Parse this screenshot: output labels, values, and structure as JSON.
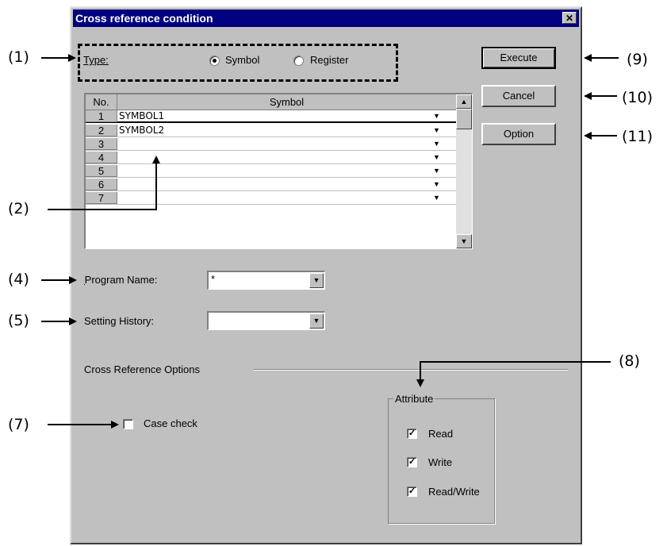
{
  "dialog": {
    "title": "Cross reference condition",
    "close_label": "✕"
  },
  "type_group": {
    "label": "Type:",
    "options": [
      {
        "label": "Symbol",
        "selected": true
      },
      {
        "label": "Register",
        "selected": false
      }
    ]
  },
  "grid": {
    "headers": [
      "No.",
      "Symbol"
    ],
    "rows": [
      {
        "no": "1",
        "value": "SYMBOL1"
      },
      {
        "no": "2",
        "value": "SYMBOL2"
      },
      {
        "no": "3",
        "value": ""
      },
      {
        "no": "4",
        "value": ""
      },
      {
        "no": "5",
        "value": ""
      },
      {
        "no": "6",
        "value": ""
      },
      {
        "no": "7",
        "value": ""
      }
    ],
    "dropdown_icon": "▼",
    "scroll_up_icon": "▲",
    "scroll_down_icon": "▼"
  },
  "buttons": {
    "execute": "Execute",
    "cancel": "Cancel",
    "option": "Option"
  },
  "program_name": {
    "label": "Program Name:",
    "value": "*"
  },
  "setting_history": {
    "label": "Setting History:",
    "value": ""
  },
  "cross_reference_options": {
    "label": "Cross Reference Options"
  },
  "case_check": {
    "label": "Case check",
    "checked": false
  },
  "attribute": {
    "label": "Attribute",
    "items": [
      {
        "label": "Read",
        "checked": true
      },
      {
        "label": "Write",
        "checked": true
      },
      {
        "label": "Read/Write",
        "checked": true
      }
    ]
  },
  "callouts": {
    "c1": "(1)",
    "c2": "(2)",
    "c4": "(4)",
    "c5": "(5)",
    "c7": "(7)",
    "c8": "(8)",
    "c9": "(9)",
    "c10": "(10)",
    "c11": "(11)"
  }
}
